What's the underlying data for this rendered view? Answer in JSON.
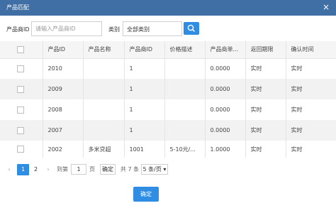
{
  "dialog": {
    "title": "产品匹配",
    "close_label": "×"
  },
  "filter": {
    "product_id_label": "产品商ID",
    "product_id_placeholder": "请输入产品商ID",
    "product_id_value": "",
    "category_label": "类别",
    "category_value": "全部类别"
  },
  "table": {
    "headers": [
      "",
      "产品ID",
      "产品名称",
      "产品商ID",
      "价格描述",
      "产品商单...",
      "返回期限",
      "确认时间"
    ],
    "rows": [
      [
        "2010",
        "",
        "1",
        "",
        "0.0000",
        "实时",
        "实时"
      ],
      [
        "2009",
        "",
        "1",
        "",
        "0.0000",
        "实时",
        "实时"
      ],
      [
        "2008",
        "",
        "1",
        "",
        "0.0000",
        "实时",
        "实时"
      ],
      [
        "2007",
        "",
        "1",
        "",
        "0.0000",
        "实时",
        "实时"
      ],
      [
        "2002",
        "多米贷超",
        "1001",
        "5-10元/...",
        "1.0000",
        "实时",
        "实时"
      ]
    ]
  },
  "pagination": {
    "prev": "‹",
    "pages": [
      "1",
      "2"
    ],
    "current_page": "1",
    "next": "›",
    "goto_label": "到第",
    "goto_value": "1",
    "page_unit": "页",
    "go_button": "确定",
    "total_text": "共 7 条",
    "page_size": "5 条/页",
    "page_size_caret": "▾"
  },
  "footer": {
    "confirm_label": "确定"
  },
  "colors": {
    "titlebar": "#3f6fa5",
    "primary": "#2f8de4"
  }
}
